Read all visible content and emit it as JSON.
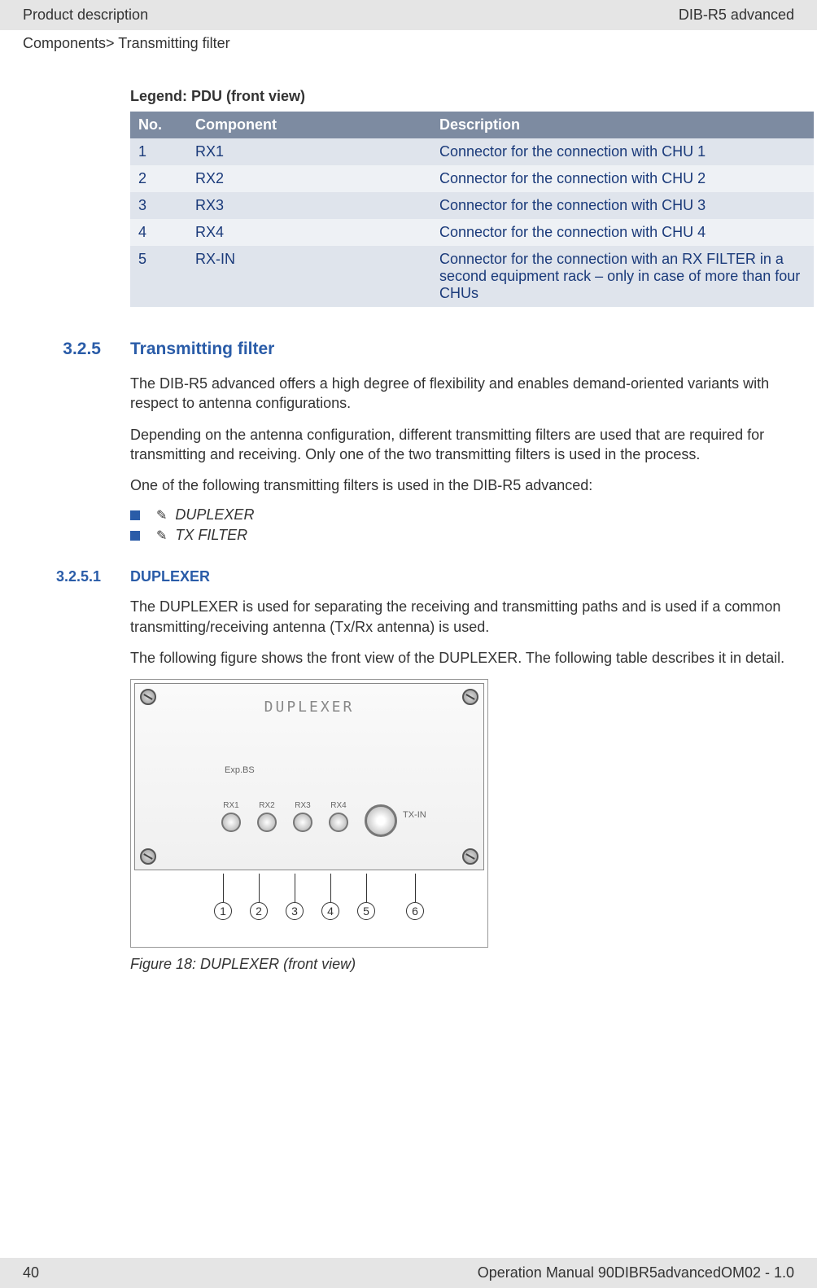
{
  "header": {
    "left": "Product description",
    "right": "DIB-R5 advanced"
  },
  "breadcrumb": "Components> Transmitting filter",
  "legend": {
    "title": "Legend: PDU (front view)",
    "headers": {
      "no": "No.",
      "component": "Component",
      "description": "Description"
    },
    "rows": [
      {
        "no": "1",
        "component": "RX1",
        "description": "Connector for the connection with CHU 1"
      },
      {
        "no": "2",
        "component": "RX2",
        "description": "Connector for the connection with CHU 2"
      },
      {
        "no": "3",
        "component": "RX3",
        "description": "Connector for the connection with CHU 3"
      },
      {
        "no": "4",
        "component": "RX4",
        "description": "Connector for the connection with CHU 4"
      },
      {
        "no": "5",
        "component": "RX-IN",
        "description": "Connector for the connection with an RX FILTER in a second equipment rack – only in case of more than four CHUs"
      }
    ]
  },
  "section": {
    "number": "3.2.5",
    "title": "Transmitting filter",
    "paras": [
      "The DIB-R5 advanced offers a high degree of flexibility and enables demand-oriented variants with respect to antenna configurations.",
      "Depending on the antenna configuration, different transmitting filters are used that are required for transmitting and receiving. Only one of the two transmitting filters is used in the process.",
      "One of the following transmitting filters is used in the DIB-R5 advanced:"
    ],
    "bullets": [
      "DUPLEXER",
      "TX FILTER"
    ]
  },
  "subsection": {
    "number": "3.2.5.1",
    "title": "DUPLEXER",
    "paras": [
      "The DUPLEXER is used for separating the receiving and transmitting paths and is used if a common transmitting/receiving antenna (Tx/Rx antenna) is used.",
      "The following figure shows the front view of the DUPLEXER. The following table describes it in detail."
    ]
  },
  "figure": {
    "panel_title": "DUPLEXER",
    "labels": {
      "exp": "Exp.BS",
      "txin": "TX-IN",
      "rx1": "RX1",
      "rx2": "RX2",
      "rx3": "RX3",
      "rx4": "RX4"
    },
    "callouts": [
      "1",
      "2",
      "3",
      "4",
      "5",
      "6"
    ],
    "caption": "Figure 18: DUPLEXER (front view)"
  },
  "footer": {
    "page": "40",
    "right": "Operation Manual 90DIBR5advancedOM02 - 1.0"
  }
}
